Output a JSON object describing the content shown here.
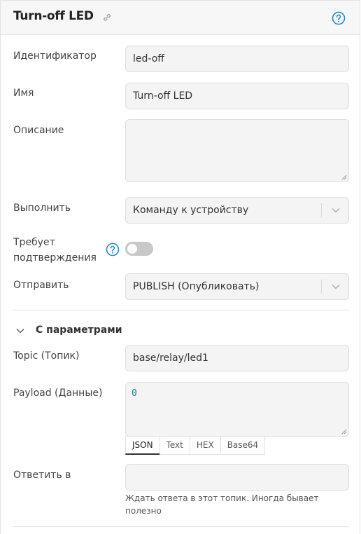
{
  "header": {
    "title": "Turn-off LED"
  },
  "fields": {
    "identifier": {
      "label": "Идентификатор",
      "value": "led-off"
    },
    "name": {
      "label": "Имя",
      "value": "Turn-off LED"
    },
    "description": {
      "label": "Описание",
      "value": ""
    },
    "execute": {
      "label": "Выполнить",
      "value": "Команду к устройству"
    },
    "confirm": {
      "label_line1": "Требует",
      "label_line2": "подтверждения",
      "enabled": false
    },
    "send": {
      "label": "Отправить",
      "value": "PUBLISH (Опубликовать)"
    }
  },
  "params": {
    "section_title": "С параметрами",
    "topic": {
      "label": "Topic (Топик)",
      "value": "base/relay/led1"
    },
    "payload": {
      "label": "Payload (Данные)",
      "value": "0",
      "tabs": [
        "JSON",
        "Text",
        "HEX",
        "Base64"
      ],
      "active_tab": "JSON"
    },
    "reply": {
      "label": "Ответить в",
      "value": "",
      "hint": "Ждать ответа в этот топик. Иногда бывает полезно"
    }
  },
  "colors": {
    "accent": "#2b8ac6",
    "field_bg": "#f4f4f4",
    "toggle_off": "#c8c8c8"
  }
}
